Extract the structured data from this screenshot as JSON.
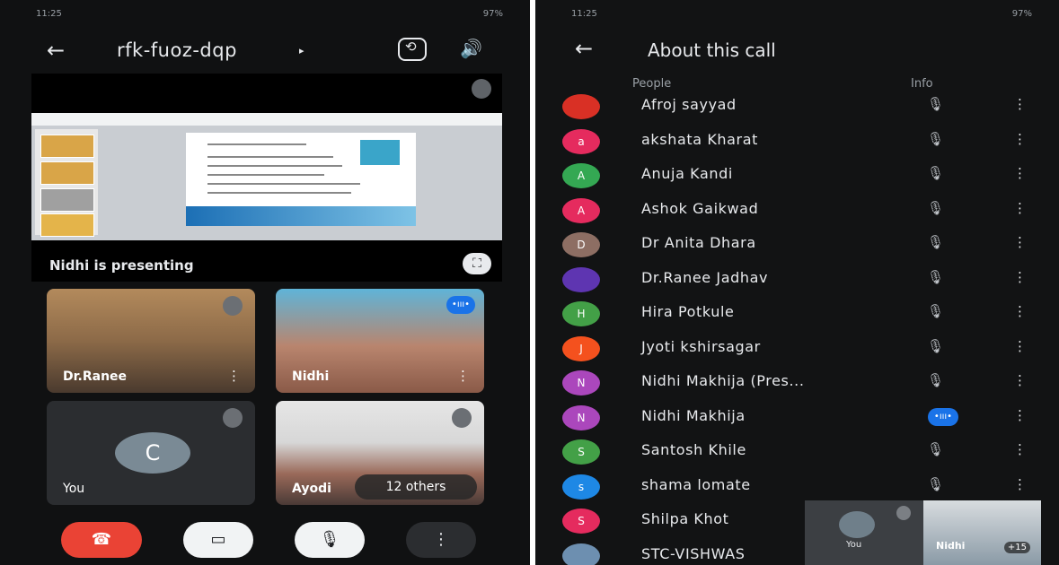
{
  "colors": {
    "end_call": "#ea4335",
    "speaking_blue": "#1a73e8",
    "background": "#101112"
  },
  "left": {
    "status": {
      "time": "11:25",
      "battery": "97%"
    },
    "meeting_code": "rfk-fuoz-dqp",
    "caret": "▸",
    "icons": {
      "back": "arrow-left-icon",
      "switch_camera": "switch-camera-icon",
      "speaker": "speaker-icon"
    },
    "presenting_label": "Nidhi is presenting",
    "tiles": [
      {
        "name": "Dr.Ranee",
        "muted": true
      },
      {
        "name": "Nidhi",
        "speaking": true
      },
      {
        "name": "You",
        "avatar_letter": "C",
        "muted": true
      },
      {
        "name": "Ayodi",
        "muted": true,
        "others_label": "12 others"
      }
    ],
    "controls": {
      "end_call": "end-call-icon",
      "camera": "camera-off-icon",
      "mic": "mic-off-icon",
      "more": "more-vert-icon"
    }
  },
  "right": {
    "status": {
      "time": "11:25",
      "battery": "97%"
    },
    "title": "About this call",
    "columns": {
      "people": "People",
      "info": "Info"
    },
    "people": [
      {
        "name": "Afroj sayyad",
        "avatar_letter": "",
        "color": "#d93025"
      },
      {
        "name": "akshata Kharat",
        "avatar_letter": "a",
        "color": "#e52b5e"
      },
      {
        "name": "Anuja Kandi",
        "avatar_letter": "A",
        "color": "#34a853"
      },
      {
        "name": "Ashok Gaikwad",
        "avatar_letter": "A",
        "color": "#e52b5e"
      },
      {
        "name": "Dr Anita Dhara",
        "avatar_letter": "D",
        "color": "#8d6e63"
      },
      {
        "name": "Dr.Ranee Jadhav",
        "avatar_letter": "",
        "color": "#5e35b1"
      },
      {
        "name": "Hira Potkule",
        "avatar_letter": "H",
        "color": "#43a047"
      },
      {
        "name": "Jyoti kshirsagar",
        "avatar_letter": "J",
        "color": "#f4511e"
      },
      {
        "name": "Nidhi Makhija (Pres...",
        "avatar_letter": "N",
        "color": "#ab47bc"
      },
      {
        "name": "Nidhi Makhija",
        "avatar_letter": "N",
        "color": "#ab47bc",
        "speaking": true
      },
      {
        "name": "Santosh Khile",
        "avatar_letter": "S",
        "color": "#43a047"
      },
      {
        "name": "shama lomate",
        "avatar_letter": "s",
        "color": "#1e88e5"
      },
      {
        "name": "Shilpa Khot",
        "avatar_letter": "S",
        "color": "#e52b5e"
      },
      {
        "name": "STC-VISHWAS",
        "avatar_letter": "",
        "color": "#6d8fb0"
      }
    ],
    "mini_tiles": {
      "you": "You",
      "nidhi": "Nidhi",
      "count": "+15"
    }
  }
}
